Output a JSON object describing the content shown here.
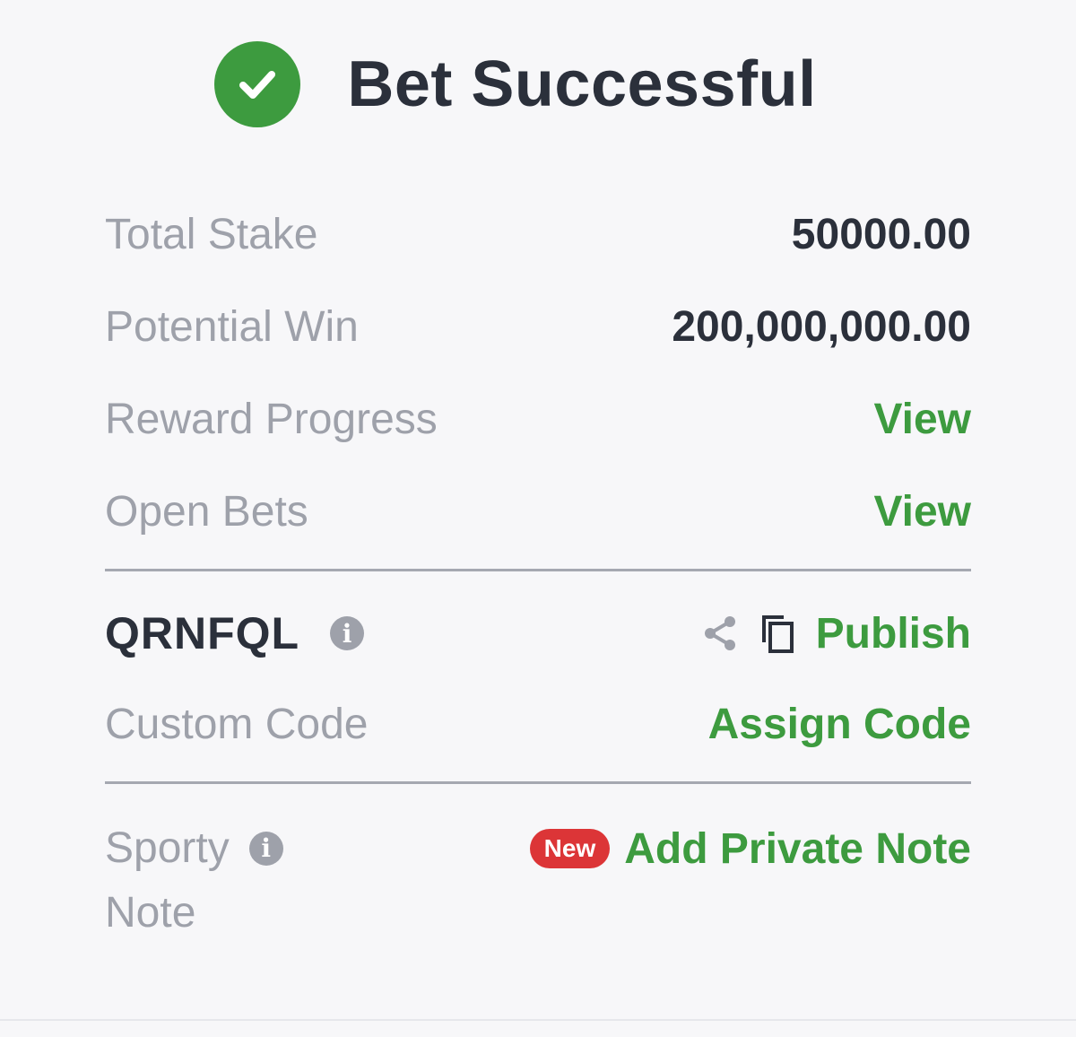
{
  "header": {
    "title": "Bet Successful",
    "status_icon": "check-circle-icon",
    "accent_color": "#3d9b3f"
  },
  "summary": {
    "total_stake_label": "Total Stake",
    "total_stake_value": "50000.00",
    "potential_win_label": "Potential Win",
    "potential_win_value": "200,000,000.00",
    "reward_progress_label": "Reward Progress",
    "reward_progress_link": "View",
    "open_bets_label": "Open Bets",
    "open_bets_link": "View"
  },
  "booking": {
    "code": "QRNFQL",
    "info_icon": "i",
    "publish_label": "Publish",
    "custom_code_label": "Custom Code",
    "assign_code_label": "Assign Code"
  },
  "note": {
    "label_line1": "Sporty",
    "label_line2": "Note",
    "info_icon": "i",
    "badge": "New",
    "badge_color": "#dc3537",
    "add_note_label": "Add Private Note"
  }
}
